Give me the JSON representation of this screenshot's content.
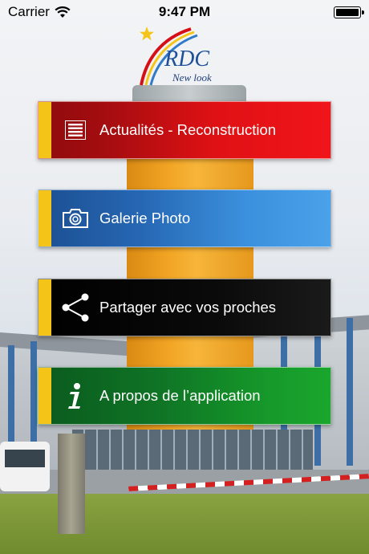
{
  "status_bar": {
    "carrier": "Carrier",
    "time": "9:47 PM"
  },
  "logo": {
    "text": "RDC",
    "subtitle": "New look"
  },
  "menu": [
    {
      "label": "Actualités - Reconstruction",
      "icon": "list-icon",
      "color": "#d41016"
    },
    {
      "label": "Galerie Photo",
      "icon": "camera-icon",
      "color": "#2f7ac9"
    },
    {
      "label": "Partager avec vos proches",
      "icon": "share-icon",
      "color": "#000000"
    },
    {
      "label": "A propos de l’application",
      "icon": "info-icon",
      "color": "#12882a"
    }
  ],
  "colors": {
    "accent": "#f4c518"
  }
}
